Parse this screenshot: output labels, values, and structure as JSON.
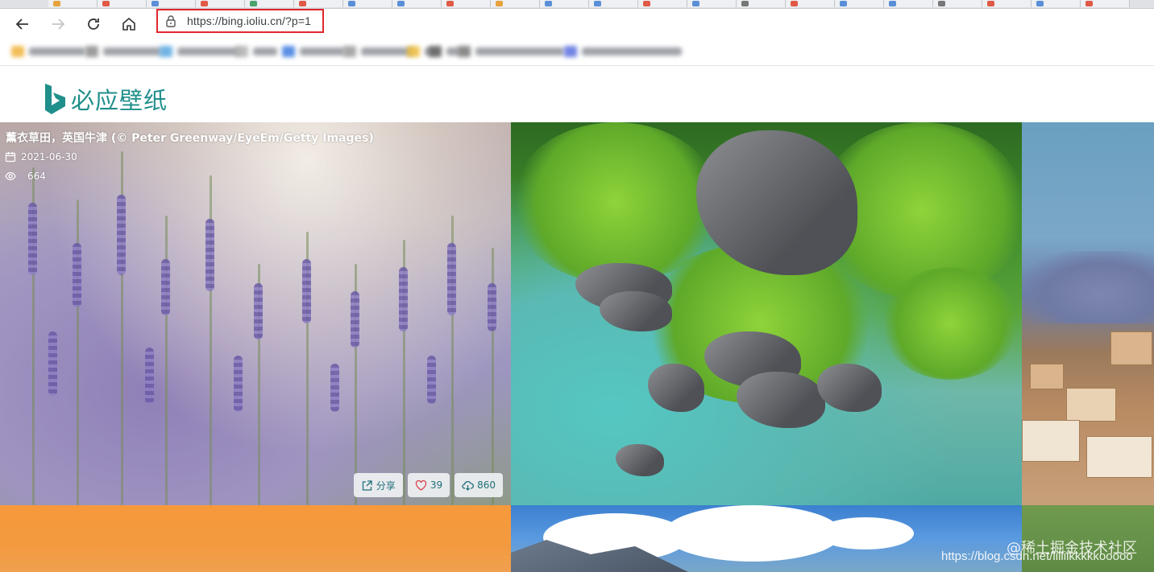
{
  "browser": {
    "address_url": "https://bing.ioliu.cn/?p=1"
  },
  "site": {
    "logo_text": "必应壁纸"
  },
  "featured": {
    "caption": "薰衣草田，英国牛津 (© Peter Greenway/EyeEm/Getty Images)",
    "date": "2021-06-30",
    "views": "664",
    "share_label": "分享",
    "likes": "39",
    "downloads": "860"
  },
  "watermark": {
    "line1": "@稀土掘金技术社区",
    "line2": "https://blog.csdn.net/lilliikkkkkooooo"
  },
  "colors": {
    "brand": "#1f8f8b",
    "highlight_border": "#e0282e"
  }
}
